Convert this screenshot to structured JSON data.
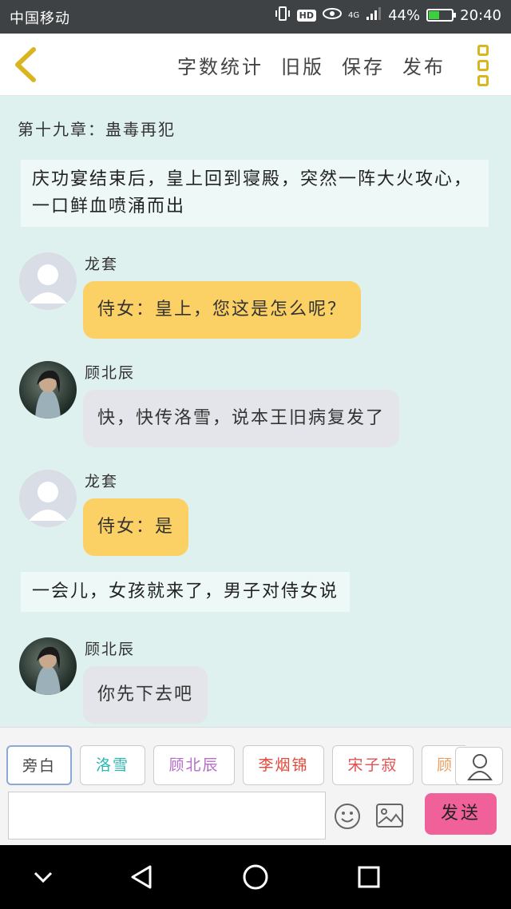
{
  "status_bar": {
    "carrier": "中国移动",
    "signal_label": "4G",
    "battery": "44%",
    "battery_level": 0.44,
    "time": "20:40",
    "hd_label": "HD"
  },
  "toolbar": {
    "actions": [
      "字数统计",
      "旧版",
      "保存",
      "发布"
    ]
  },
  "content": {
    "chapter_title": "第十九章：蛊毒再犯",
    "messages": [
      {
        "type": "narration",
        "text": "庆功宴结束后，皇上回到寝殿，突然一阵大火攻心，一口鲜血喷涌而出"
      },
      {
        "type": "chat",
        "name": "龙套",
        "text": "侍女：皇上，您这是怎么呢？",
        "bubble": "yellow",
        "avatar": "default"
      },
      {
        "type": "chat",
        "name": "顾北辰",
        "text": "快，快传洛雪，说本王旧病复发了",
        "bubble": "gray",
        "avatar": "photo"
      },
      {
        "type": "chat",
        "name": "龙套",
        "text": "侍女：是",
        "bubble": "yellow",
        "avatar": "default"
      },
      {
        "type": "narration",
        "text": "一会儿，女孩就来了，男子对侍女说"
      },
      {
        "type": "chat",
        "name": "顾北辰",
        "text": "你先下去吧",
        "bubble": "gray",
        "avatar": "photo"
      }
    ]
  },
  "input": {
    "characters": [
      {
        "label": "旁白",
        "color": "#444444"
      },
      {
        "label": "洛雪",
        "color": "#2bb7b0"
      },
      {
        "label": "顾北辰",
        "color": "#b56fc8"
      },
      {
        "label": "李烟锦",
        "color": "#e0483a"
      },
      {
        "label": "宋子寂",
        "color": "#e25050"
      },
      {
        "label": "顾",
        "color": "#e8a060"
      }
    ],
    "selected_index": 0,
    "text_value": "",
    "send_label": "发送"
  },
  "colors": {
    "accent_yellow": "#fbd165",
    "send_pink": "#f0619a",
    "background": "#dff1ee"
  }
}
